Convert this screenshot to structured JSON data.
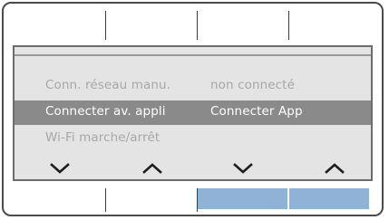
{
  "screen": {
    "rows": [
      {
        "label": "Conn. réseau manu.",
        "value": "non connecté",
        "state": "dim"
      },
      {
        "label": "Connecter av. appli",
        "value": "Connecter App",
        "state": "selected"
      },
      {
        "label": "Wi-Fi marche/arrêt",
        "value": "",
        "state": "dim"
      }
    ]
  },
  "softkeys": {
    "arrows": [
      "chevron-down-icon",
      "chevron-up-icon",
      "chevron-down-icon",
      "chevron-up-icon"
    ]
  },
  "colors": {
    "screen_bg": "#e4e4e4",
    "selected_row": "#8a8a8a",
    "dim_text": "#a7a7a7",
    "active_key": "#8fb3d6"
  }
}
